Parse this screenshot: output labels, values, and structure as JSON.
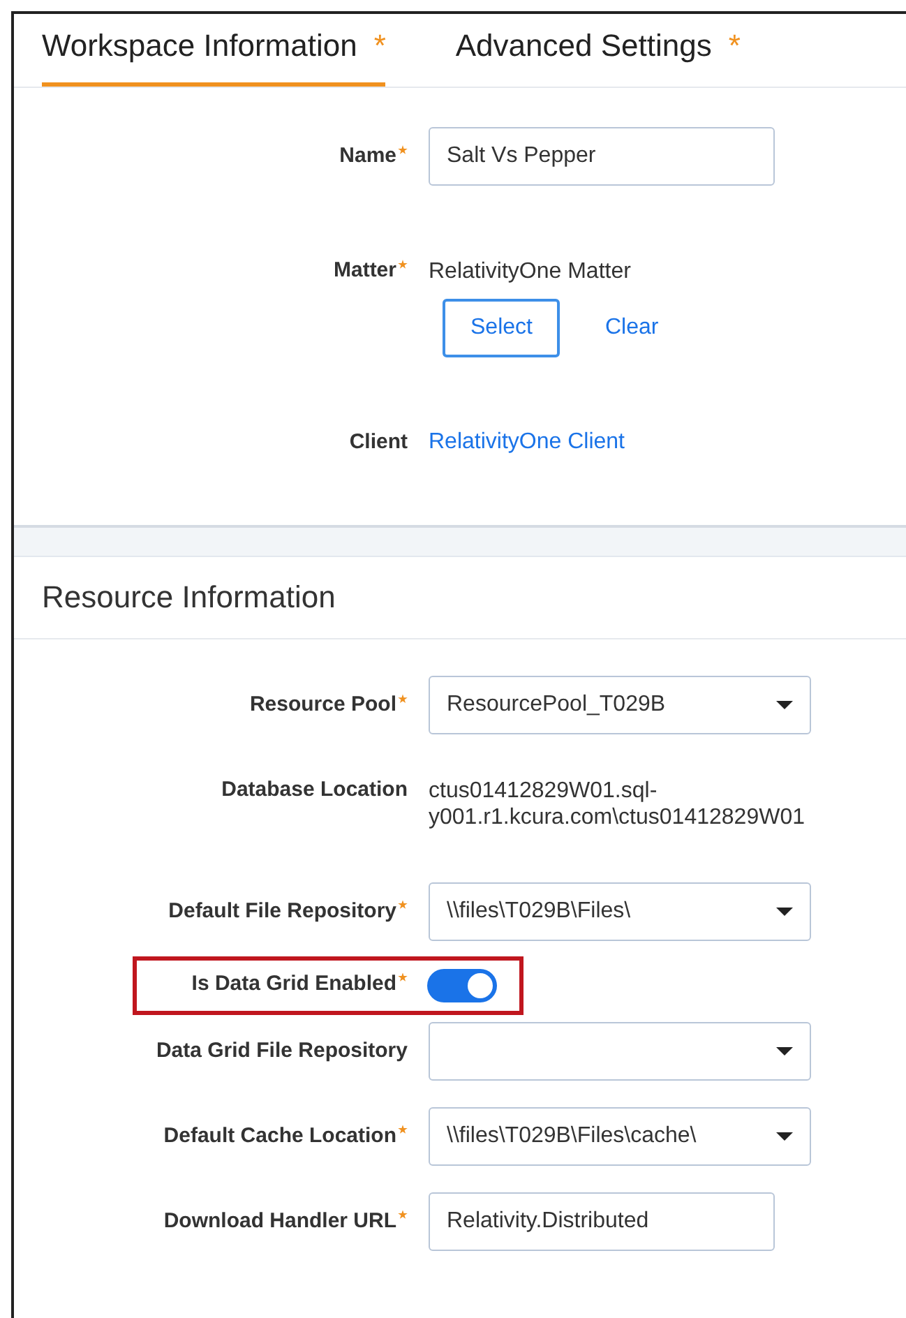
{
  "tabs": [
    {
      "label": "Workspace Information",
      "marker": "*",
      "selected": true
    },
    {
      "label": "Advanced Settings",
      "marker": "*",
      "selected": false
    }
  ],
  "workspace_fields": [
    {
      "kind": "input",
      "label": "Name",
      "required": true,
      "value": "Salt Vs Pepper"
    },
    {
      "kind": "picker",
      "label": "Matter",
      "required": true,
      "value": "RelativityOne Matter",
      "buttons": [
        {
          "label": "Select",
          "kind": "outline"
        },
        {
          "label": "Clear",
          "kind": "link"
        }
      ]
    },
    {
      "kind": "link",
      "label": "Client",
      "required": false,
      "value": "RelativityOne Client"
    }
  ],
  "resource_section": {
    "title": "Resource Information",
    "fields": [
      {
        "kind": "select",
        "label": "Resource Pool",
        "required": true,
        "value": "ResourcePool_T029B",
        "highlighted": false
      },
      {
        "kind": "text",
        "label": "Database Location",
        "required": false,
        "value": "ctus01412829W01.sql-y001.r1.kcura.com\\ctus01412829W01",
        "highlighted": false
      },
      {
        "kind": "select",
        "label": "Default File Repository",
        "required": true,
        "value": "\\\\files\\T029B\\Files\\",
        "highlighted": false
      },
      {
        "kind": "toggle",
        "label": "Is Data Grid Enabled",
        "required": true,
        "on": true,
        "highlighted": true
      },
      {
        "kind": "select",
        "label": "Data Grid File Repository",
        "required": false,
        "highlighted": false
      },
      {
        "kind": "select",
        "label": "Default Cache Location",
        "required": true,
        "value": "\\\\files\\T029B\\Files\\cache\\",
        "highlighted": false
      },
      {
        "kind": "input",
        "label": "Download Handler URL",
        "required": true,
        "value": "Relativity.Distributed",
        "highlighted": false
      }
    ]
  }
}
